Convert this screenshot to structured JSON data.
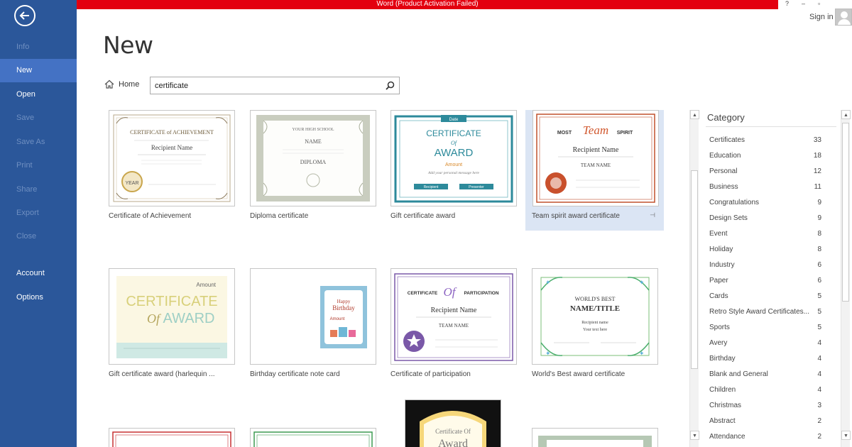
{
  "titlebar": {
    "activation": "Word (Product Activation Failed)",
    "controls": [
      "?",
      "–",
      "▫"
    ],
    "sign_in": "Sign in"
  },
  "sidebar": {
    "items": [
      {
        "label": "Info",
        "state": "disabled"
      },
      {
        "label": "New",
        "state": "active"
      },
      {
        "label": "Open",
        "state": "enabled"
      },
      {
        "label": "Save",
        "state": "disabled"
      },
      {
        "label": "Save As",
        "state": "disabled"
      },
      {
        "label": "Print",
        "state": "disabled"
      },
      {
        "label": "Share",
        "state": "disabled"
      },
      {
        "label": "Export",
        "state": "disabled"
      },
      {
        "label": "Close",
        "state": "disabled"
      },
      {
        "label": "Account",
        "state": "enabled"
      },
      {
        "label": "Options",
        "state": "enabled"
      }
    ]
  },
  "main": {
    "title": "New",
    "home_label": "Home",
    "search_value": "certificate"
  },
  "templates": [
    {
      "label": "Certificate of Achievement",
      "lines": [
        "CERTIFICATE of ACHIEVEMENT",
        "Recipient Name",
        "YEAR"
      ]
    },
    {
      "label": "Diploma certificate",
      "lines": [
        "YOUR HIGH SCHOOL",
        "NAME",
        "DIPLOMA"
      ]
    },
    {
      "label": "Gift certificate award",
      "lines": [
        "Date",
        "CERTIFICATE",
        "Of",
        "AWARD",
        "Amount",
        "Add your personal message here",
        "Recipient",
        "Presenter"
      ]
    },
    {
      "label": "Team spirit award certificate",
      "lines": [
        "MOST",
        "Team",
        "SPIRIT",
        "Recipient Name",
        "TEAM NAME"
      ]
    },
    {
      "label": "Gift certificate award (harlequin ...",
      "lines": [
        "Amount",
        "CERTIFICATE",
        "Of",
        "AWARD"
      ]
    },
    {
      "label": "Birthday certificate note card",
      "lines": [
        "Happy",
        "Birthday",
        "Amount"
      ]
    },
    {
      "label": "Certificate of participation",
      "lines": [
        "CERTIFICATE",
        "Of",
        "PARTICIPATION",
        "Recipient Name",
        "TEAM NAME"
      ]
    },
    {
      "label": "World's Best award certificate",
      "lines": [
        "WORLD'S BEST",
        "NAME/TITLE",
        "Recipient name",
        "Your text here"
      ]
    },
    {
      "label": "",
      "lines": []
    },
    {
      "label": "",
      "lines": []
    },
    {
      "label": "",
      "lines": [
        "Certificate Of",
        "Award"
      ]
    },
    {
      "label": "",
      "lines": []
    }
  ],
  "category": {
    "title": "Category",
    "items": [
      {
        "name": "Certificates",
        "count": "33"
      },
      {
        "name": "Education",
        "count": "18"
      },
      {
        "name": "Personal",
        "count": "12"
      },
      {
        "name": "Business",
        "count": "11"
      },
      {
        "name": "Congratulations",
        "count": "9"
      },
      {
        "name": "Design Sets",
        "count": "9"
      },
      {
        "name": "Event",
        "count": "8"
      },
      {
        "name": "Holiday",
        "count": "8"
      },
      {
        "name": "Industry",
        "count": "6"
      },
      {
        "name": "Paper",
        "count": "6"
      },
      {
        "name": "Cards",
        "count": "5"
      },
      {
        "name": "Retro Style Award Certificates...",
        "count": "5"
      },
      {
        "name": "Sports",
        "count": "5"
      },
      {
        "name": "Avery",
        "count": "4"
      },
      {
        "name": "Birthday",
        "count": "4"
      },
      {
        "name": "Blank and General",
        "count": "4"
      },
      {
        "name": "Children",
        "count": "4"
      },
      {
        "name": "Christmas",
        "count": "3"
      },
      {
        "name": "Abstract",
        "count": "2"
      },
      {
        "name": "Attendance",
        "count": "2"
      }
    ]
  },
  "colors": {
    "sidebar": "#2b579a",
    "sidebar_active": "#4472c4",
    "activation_bar": "#e3000f",
    "selected_tile": "#dbe5f4"
  },
  "icons": {
    "back": "back-arrow-icon",
    "home": "home-icon",
    "search": "search-icon",
    "pin": "pin-icon"
  }
}
